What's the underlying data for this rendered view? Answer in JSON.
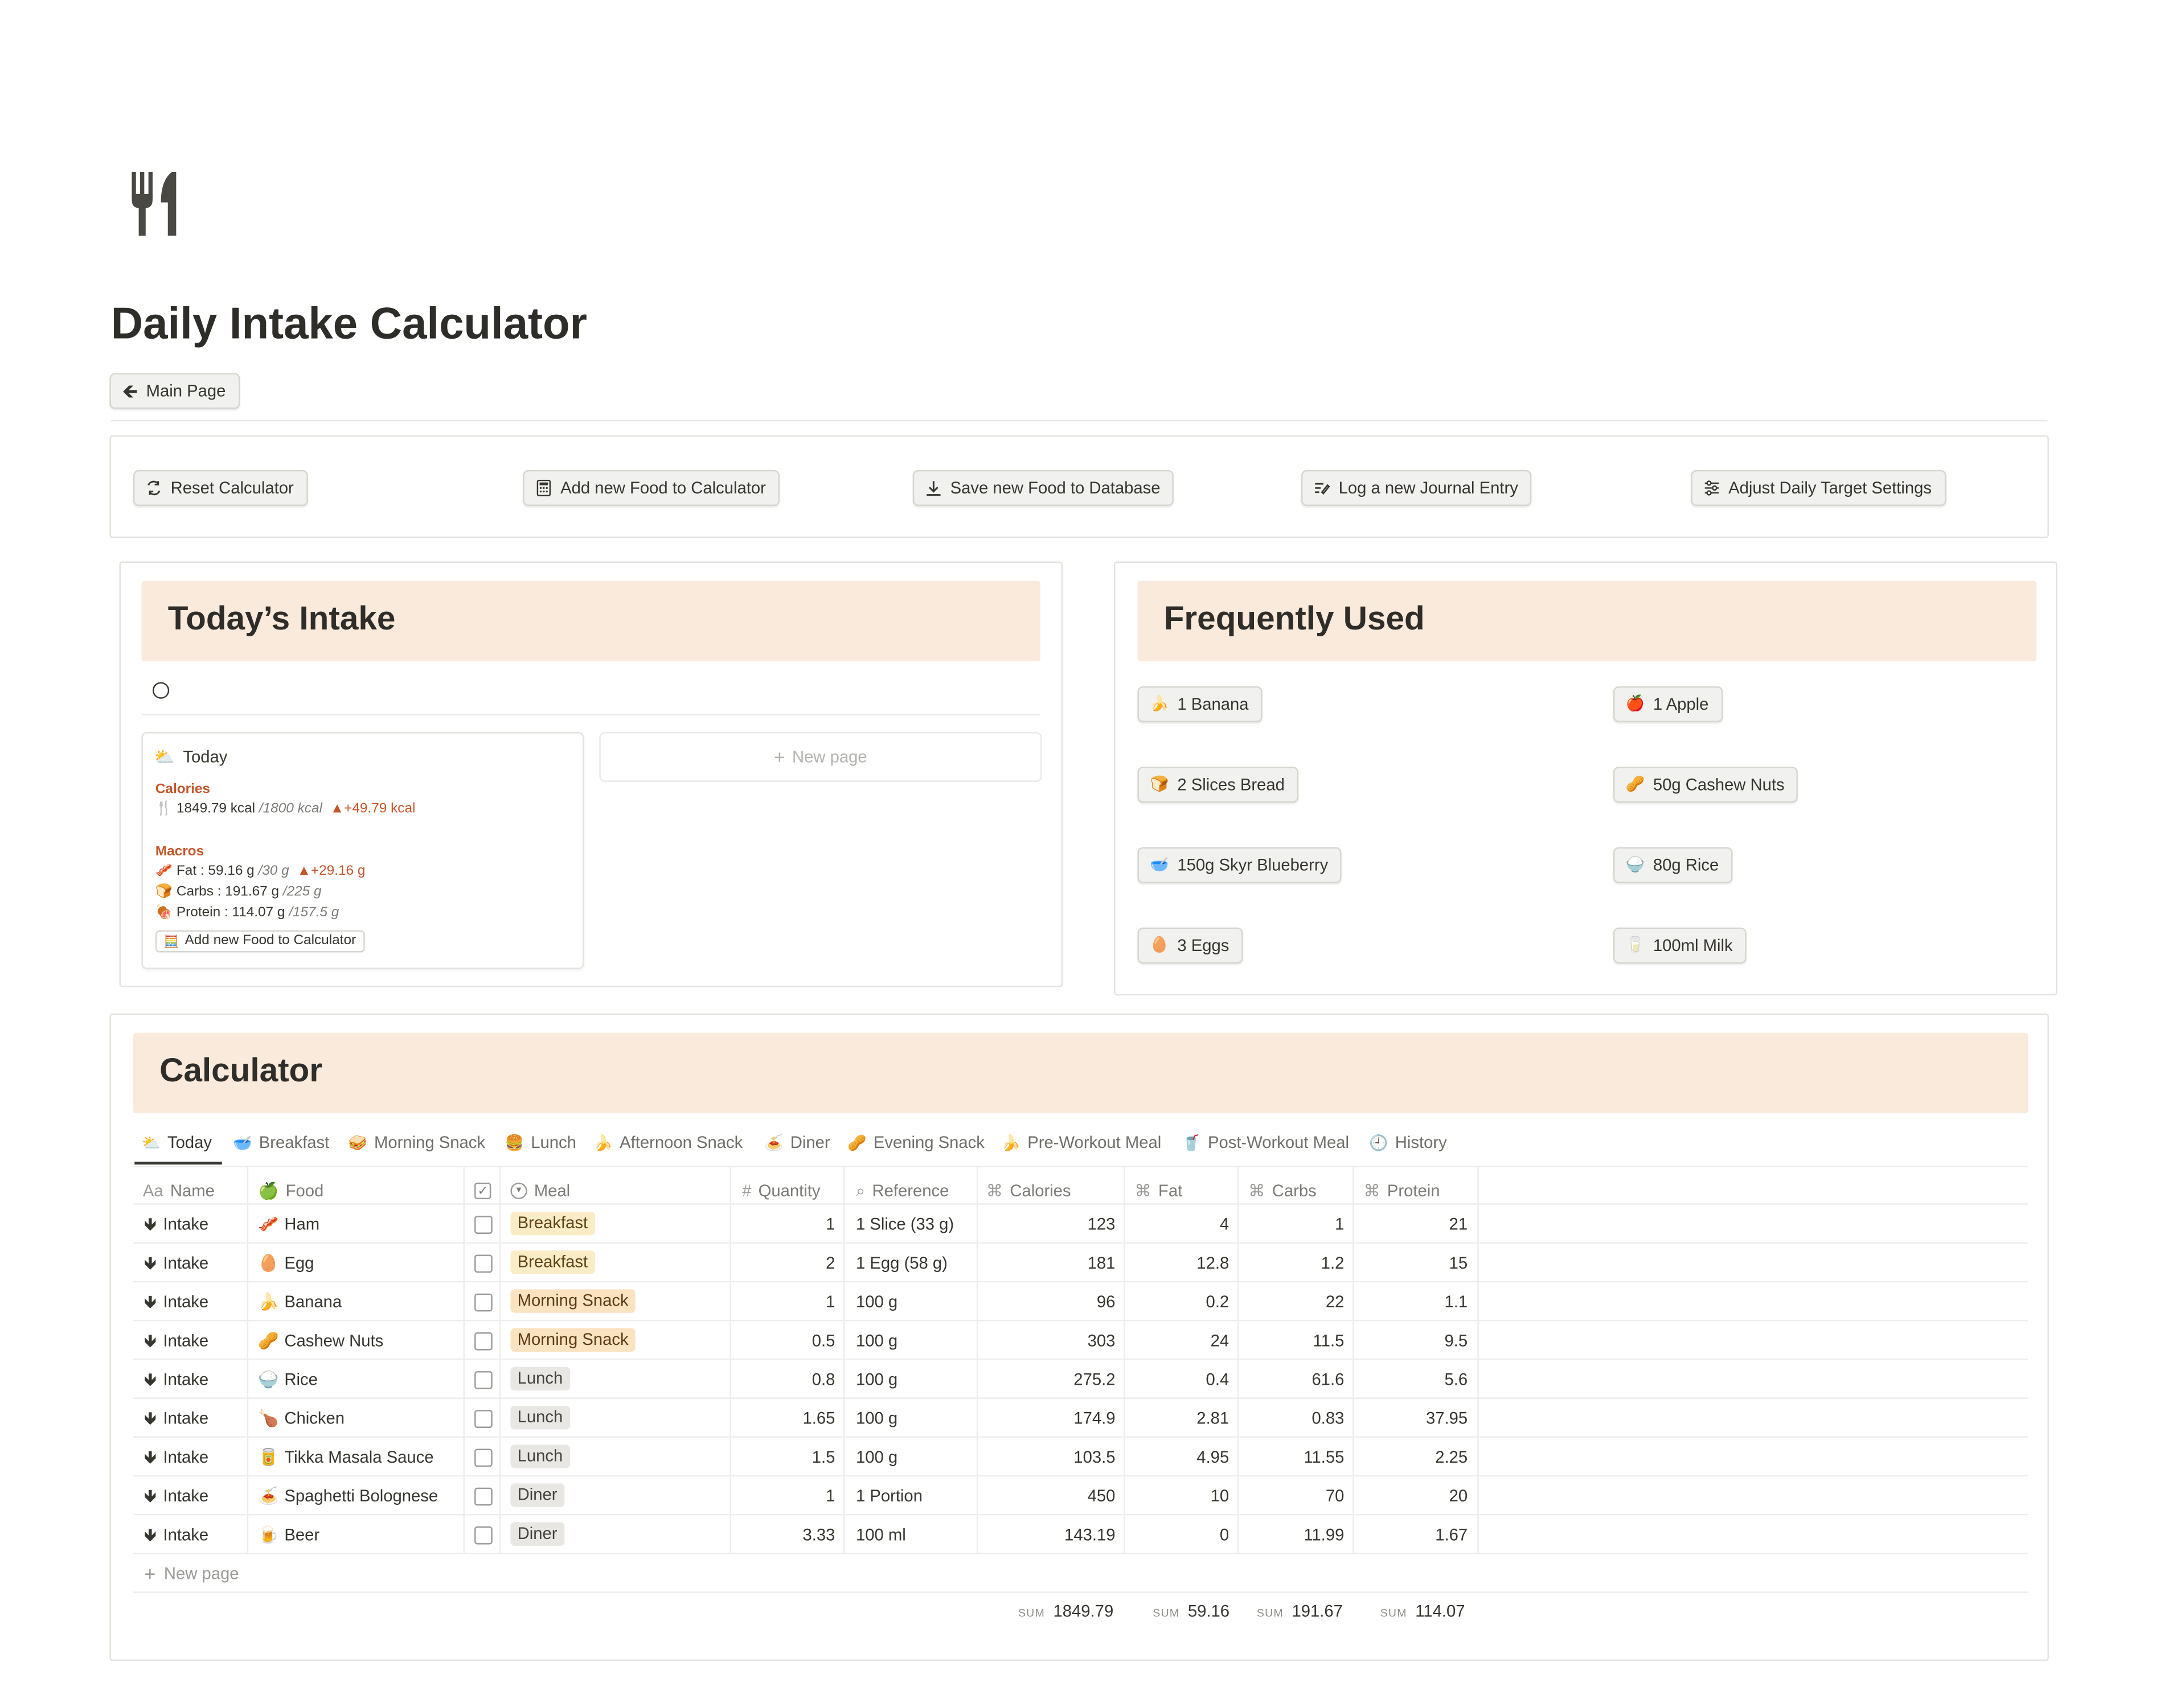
{
  "page": {
    "title": "Daily Intake Calculator",
    "main_page_button": "Main Page"
  },
  "actions": {
    "reset": "Reset Calculator",
    "add_food": "Add new Food to Calculator",
    "save_food": "Save new Food to Database",
    "journal": "Log a new Journal Entry",
    "adjust": "Adjust Daily Target Settings"
  },
  "intake": {
    "heading": "Today’s Intake",
    "new_page": "New page",
    "card": {
      "title": "Today",
      "calories_heading": "Calories",
      "calories_value": "1849.79 kcal",
      "calories_target": "/1800 kcal",
      "calories_delta": "+49.79 kcal",
      "macros_heading": "Macros",
      "fat_value": "Fat : 59.16 g",
      "fat_target": "/30 g",
      "fat_delta": "+29.16 g",
      "carbs_value": "Carbs : 191.67 g",
      "carbs_target": "/225 g",
      "protein_value": "Protein : 114.07 g",
      "protein_target": "/157.5 g",
      "add_button": "Add new Food to Calculator"
    }
  },
  "frequent": {
    "heading": "Frequently Used",
    "items": [
      {
        "emoji": "🍌",
        "label": "1 Banana"
      },
      {
        "emoji": "🍎",
        "label": "1 Apple"
      },
      {
        "emoji": "🍞",
        "label": "2 Slices Bread"
      },
      {
        "emoji": "🥜",
        "label": "50g Cashew Nuts"
      },
      {
        "emoji": "🥣",
        "label": "150g Skyr Blueberry"
      },
      {
        "emoji": "🍚",
        "label": "80g Rice"
      },
      {
        "emoji": "🥚",
        "label": "3 Eggs"
      },
      {
        "emoji": "🥛",
        "label": "100ml Milk"
      }
    ]
  },
  "calculator": {
    "heading": "Calculator",
    "tabs": [
      "Today",
      "Breakfast",
      "Morning Snack",
      "Lunch",
      "Afternoon Snack",
      "Diner",
      "Evening Snack",
      "Pre-Workout Meal",
      "Post-Workout Meal",
      "History"
    ],
    "columns": {
      "name": "Name",
      "name_prefix": "Aa",
      "food": "Food",
      "meal": "Meal",
      "quantity": "Quantity",
      "reference": "Reference",
      "calories": "Calories",
      "fat": "Fat",
      "carbs": "Carbs",
      "protein": "Protein"
    },
    "rows": [
      {
        "name": "Intake",
        "emoji": "🥓",
        "food": "Ham",
        "meal": "Breakfast",
        "quantity": "1",
        "reference": "1 Slice (33 g)",
        "calories": "123",
        "fat": "4",
        "carbs": "1",
        "protein": "21"
      },
      {
        "name": "Intake",
        "emoji": "🥚",
        "food": "Egg",
        "meal": "Breakfast",
        "quantity": "2",
        "reference": "1 Egg (58 g)",
        "calories": "181",
        "fat": "12.8",
        "carbs": "1.2",
        "protein": "15"
      },
      {
        "name": "Intake",
        "emoji": "🍌",
        "food": "Banana",
        "meal": "Morning Snack",
        "quantity": "1",
        "reference": "100 g",
        "calories": "96",
        "fat": "0.2",
        "carbs": "22",
        "protein": "1.1"
      },
      {
        "name": "Intake",
        "emoji": "🥜",
        "food": "Cashew Nuts",
        "meal": "Morning Snack",
        "quantity": "0.5",
        "reference": "100 g",
        "calories": "303",
        "fat": "24",
        "carbs": "11.5",
        "protein": "9.5"
      },
      {
        "name": "Intake",
        "emoji": "🍚",
        "food": "Rice",
        "meal": "Lunch",
        "quantity": "0.8",
        "reference": "100 g",
        "calories": "275.2",
        "fat": "0.4",
        "carbs": "61.6",
        "protein": "5.6"
      },
      {
        "name": "Intake",
        "emoji": "🍗",
        "food": "Chicken",
        "meal": "Lunch",
        "quantity": "1.65",
        "reference": "100 g",
        "calories": "174.9",
        "fat": "2.81",
        "carbs": "0.83",
        "protein": "37.95"
      },
      {
        "name": "Intake",
        "emoji": "🥫",
        "food": "Tikka Masala Sauce",
        "meal": "Lunch",
        "quantity": "1.5",
        "reference": "100 g",
        "calories": "103.5",
        "fat": "4.95",
        "carbs": "11.55",
        "protein": "2.25"
      },
      {
        "name": "Intake",
        "emoji": "🍝",
        "food": "Spaghetti Bolognese",
        "meal": "Diner",
        "quantity": "1",
        "reference": "1 Portion",
        "calories": "450",
        "fat": "10",
        "carbs": "70",
        "protein": "20"
      },
      {
        "name": "Intake",
        "emoji": "🍺",
        "food": "Beer",
        "meal": "Diner",
        "quantity": "3.33",
        "reference": "100 ml",
        "calories": "143.19",
        "fat": "0",
        "carbs": "11.99",
        "protein": "1.67"
      }
    ],
    "new_page": "New page",
    "sum_label": "SUM",
    "sums": {
      "calories": "1849.79",
      "fat": "59.16",
      "carbs": "191.67",
      "protein": "114.07"
    }
  }
}
